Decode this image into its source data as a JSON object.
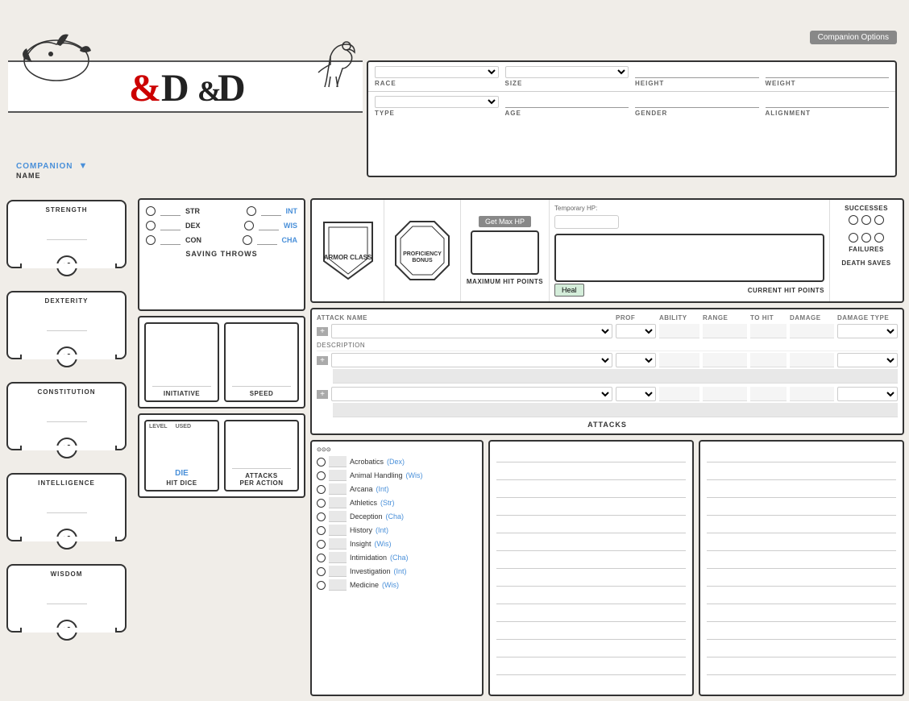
{
  "header": {
    "companion_options_label": "Companion Options",
    "companion_label": "COMPANION",
    "name_label": "NAME",
    "race_label": "RACE",
    "size_label": "SIZE",
    "height_label": "HEIGHT",
    "weight_label": "WEIGHT",
    "type_label": "TYPE",
    "age_label": "AGE",
    "gender_label": "GENDER",
    "alignment_label": "ALIGNMENT"
  },
  "saving_throws": {
    "title": "SAVING THROWS",
    "items": [
      {
        "label": "STR",
        "color": "normal"
      },
      {
        "label": "INT",
        "color": "blue"
      },
      {
        "label": "DEX",
        "color": "normal"
      },
      {
        "label": "WIS",
        "color": "blue"
      },
      {
        "label": "CON",
        "color": "normal"
      },
      {
        "label": "CHA",
        "color": "blue"
      }
    ]
  },
  "ability_scores": [
    {
      "label": "STRENGTH"
    },
    {
      "label": "DEXTERITY"
    },
    {
      "label": "CONSTITUTION"
    },
    {
      "label": "INTELLIGENCE"
    },
    {
      "label": "WISDOM"
    }
  ],
  "combat": {
    "armor_class_label": "ARMOR\nCLASS",
    "proficiency_bonus_label": "PROFICIENCY\nBONUS",
    "max_hp_label": "MAXIMUM\nHIT POINTS",
    "set_max_hp_label": "Get Max HP",
    "temp_hp_label": "Temporary HP:",
    "current_hp_label": "CURRENT HIT POINTS",
    "heal_label": "Heal",
    "death_saves_label": "DEATH SAVES",
    "successes_label": "SUCCESSES",
    "failures_label": "FAILURES",
    "initiative_label": "INITIATIVE",
    "speed_label": "SPEED",
    "level_label": "LEVEL",
    "used_label": "USED",
    "die_label": "DIE",
    "hit_dice_label": "HIT DICE",
    "attacks_per_action_label": "ATTACKS\nPER ACTION"
  },
  "attacks": {
    "headers": {
      "attack_name": "ATTACK NAME",
      "prof": "PROF",
      "ability": "ABILITY",
      "range": "RANGE",
      "to_hit": "TO HIT",
      "damage": "DAMAGE",
      "damage_type": "DAMAGE TYPE"
    },
    "description_label": "DESCRIPTION",
    "title": "ATTACKS"
  },
  "skills": {
    "items": [
      {
        "name": "Acrobatics",
        "attr": "(Dex)"
      },
      {
        "name": "Animal Handling",
        "attr": "(Wis)"
      },
      {
        "name": "Arcana",
        "attr": "(Int)"
      },
      {
        "name": "Athletics",
        "attr": "(Str)"
      },
      {
        "name": "Deception",
        "attr": "(Cha)"
      },
      {
        "name": "History",
        "attr": "(Int)"
      },
      {
        "name": "Insight",
        "attr": "(Wis)"
      },
      {
        "name": "Intimidation",
        "attr": "(Cha)"
      },
      {
        "name": "Investigation",
        "attr": "(Int)"
      },
      {
        "name": "Medicine",
        "attr": "(Wis)"
      }
    ]
  }
}
